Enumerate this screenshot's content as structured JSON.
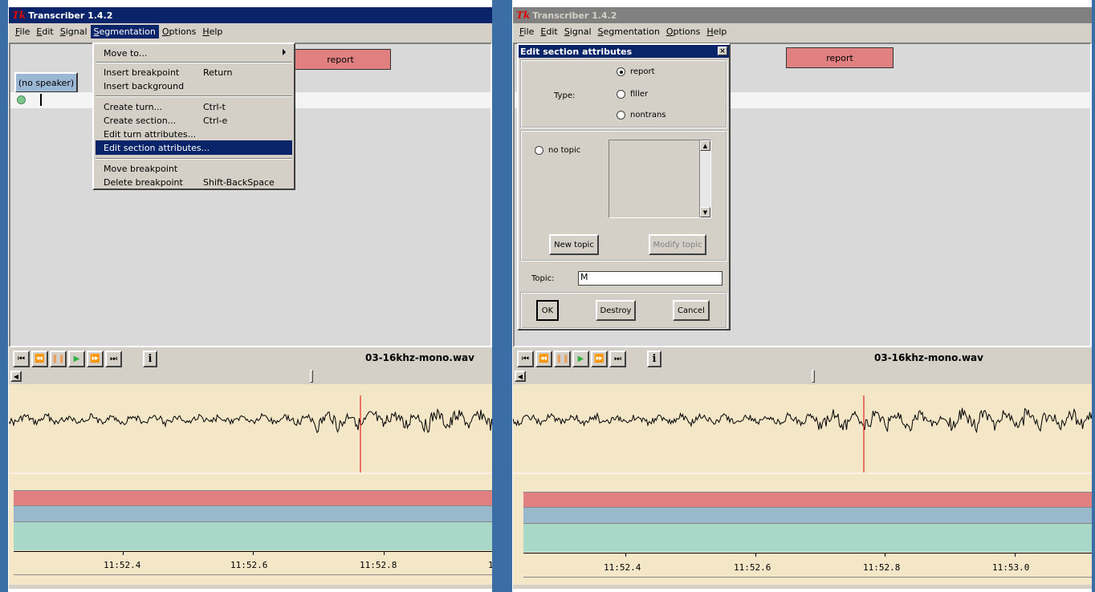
{
  "app": {
    "logo": "Tk",
    "title": "Transcriber 1.4.2"
  },
  "menu": [
    {
      "label": "File",
      "ul": "F",
      "rest": "ile"
    },
    {
      "label": "Edit",
      "ul": "E",
      "rest": "dit"
    },
    {
      "label": "Signal",
      "ul": "S",
      "rest": "ignal"
    },
    {
      "label": "Segmentation",
      "ul": "S",
      "rest": "egmentation"
    },
    {
      "label": "Options",
      "ul": "O",
      "rest": "ptions"
    },
    {
      "label": "Help",
      "ul": "H",
      "rest": "elp"
    }
  ],
  "editor": {
    "section_label": "report",
    "speaker_label": "(no speaker)"
  },
  "segmentation_menu": {
    "move_to": "Move to...",
    "insert_breakpoint": "Insert breakpoint",
    "insert_breakpoint_key": "Return",
    "insert_background": "Insert background",
    "create_turn": "Create turn...",
    "create_turn_key": "Ctrl-t",
    "create_section": "Create section...",
    "create_section_key": "Ctrl-e",
    "edit_turn_attributes": "Edit turn attributes...",
    "edit_section_attributes": "Edit section attributes...",
    "move_breakpoint": "Move breakpoint",
    "delete_breakpoint": "Delete breakpoint",
    "delete_breakpoint_key": "Shift-BackSpace"
  },
  "dialog": {
    "title": "Edit section attributes",
    "close": "×",
    "type_label": "Type:",
    "types": [
      "report",
      "filler",
      "nontrans"
    ],
    "selected_type": "report",
    "no_topic": "no topic",
    "new_topic": "New topic",
    "modify_topic": "Modify topic",
    "topic_label": "Topic:",
    "topic_value": "M",
    "ok": "OK",
    "destroy": "Destroy",
    "cancel": "Cancel"
  },
  "player": {
    "filename": "03-16khz-mono.wav",
    "buttons": [
      "◀◀|",
      "◀◀",
      "||",
      "▶",
      "▶▶",
      "|▶▶",
      "i"
    ]
  },
  "timeline_left": {
    "ticks": [
      "11:52.4",
      "11:52.6",
      "11:52.8",
      "1"
    ]
  },
  "timeline_right": {
    "ticks": [
      "11:52.4",
      "11:52.6",
      "11:52.8",
      "11:53.0"
    ]
  },
  "colors": {
    "title_active": "#0a246a",
    "section": "#e08080",
    "speaker": "#98b8cc",
    "turn": "#a8d8c8",
    "signal_bg": "#f4e7c8",
    "cursor_line": "#e00000"
  }
}
